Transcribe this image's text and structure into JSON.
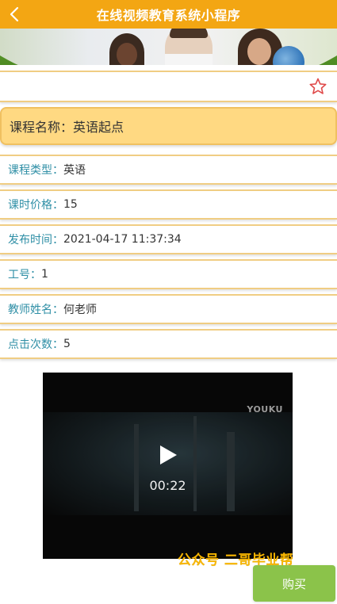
{
  "header": {
    "title": "在线视频教育系统小程序",
    "back_icon": "chevron-left-icon"
  },
  "favorite": {
    "icon": "star-outline-icon",
    "color": "#e04a4a"
  },
  "course": {
    "name_label": "课程名称：",
    "name_value": "英语起点"
  },
  "details": [
    {
      "label": "课程类型：",
      "value": "英语"
    },
    {
      "label": "课时价格：",
      "value": "15"
    },
    {
      "label": "发布时间：",
      "value": "2021-04-17 11:37:34"
    },
    {
      "label": "工号：",
      "value": "1"
    },
    {
      "label": "教师姓名：",
      "value": "何老师"
    },
    {
      "label": "点击次数：",
      "value": "5"
    }
  ],
  "video": {
    "logo": "YOUKU",
    "duration": "00:22",
    "play_icon": "play-icon"
  },
  "watermark": "公众号 二哥毕业帮",
  "actions": {
    "buy_label": "购买"
  },
  "colors": {
    "header": "#f3a613",
    "label": "#2f8fa6",
    "row_border": "#f0cd83",
    "course_bg": "#ffd982",
    "buy": "#8bc34a",
    "watermark": "#f7b500"
  }
}
